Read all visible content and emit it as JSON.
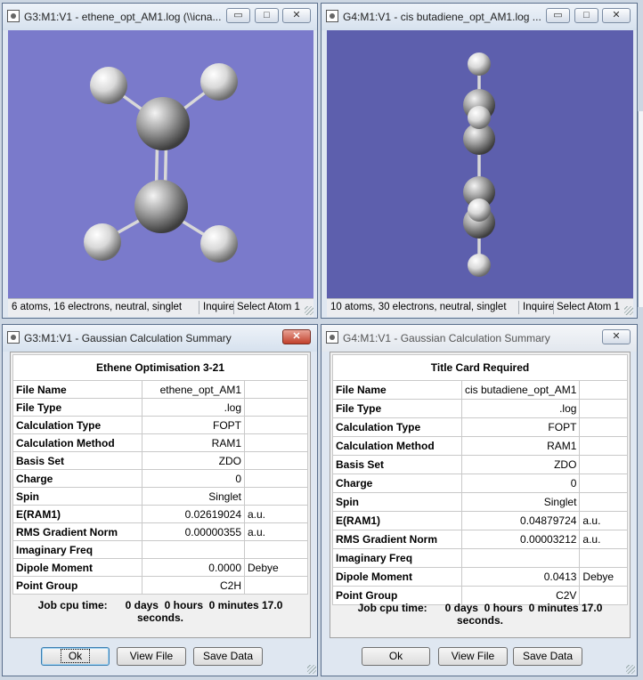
{
  "win_g3_view": {
    "title": "G3:M1:V1 - ethene_opt_AM1.log (\\\\icna...",
    "minimize": "▭",
    "maximize": "□",
    "close": "✕",
    "status": "6 atoms, 16 electrons, neutral, singlet",
    "inquire": "Inquire",
    "select_atom": "Select Atom 1",
    "bg_color": "#7a7acb"
  },
  "win_g4_view": {
    "title": "G4:M1:V1 - cis butadiene_opt_AM1.log ...",
    "minimize": "▭",
    "maximize": "□",
    "close": "✕",
    "status": "10 atoms, 30 electrons, neutral, singlet",
    "inquire": "Inquire",
    "select_atom": "Select Atom 1",
    "bg_color": "#5d5fad"
  },
  "summary_g3": {
    "title": "G3:M1:V1 - Gaussian Calculation Summary",
    "close": "✕",
    "heading": "Ethene Optimisation 3-21",
    "rows": [
      {
        "key": "File Name",
        "value": "ethene_opt_AM1",
        "unit": ""
      },
      {
        "key": "File Type",
        "value": ".log",
        "unit": ""
      },
      {
        "key": "Calculation Type",
        "value": "FOPT",
        "unit": ""
      },
      {
        "key": "Calculation Method",
        "value": "RAM1",
        "unit": ""
      },
      {
        "key": "Basis Set",
        "value": "ZDO",
        "unit": ""
      },
      {
        "key": "Charge",
        "value": "0",
        "unit": ""
      },
      {
        "key": "Spin",
        "value": "Singlet",
        "unit": ""
      },
      {
        "key": "E(RAM1)",
        "value": "0.02619024",
        "unit": "a.u."
      },
      {
        "key": "RMS Gradient Norm",
        "value": "0.00000355",
        "unit": "a.u."
      },
      {
        "key": "Imaginary Freq",
        "value": "",
        "unit": ""
      },
      {
        "key": "Dipole Moment",
        "value": "0.0000",
        "unit": "Debye"
      },
      {
        "key": "Point Group",
        "value": "C2H",
        "unit": ""
      }
    ],
    "cpu_line1": "Job cpu time:      0 days  0 hours  0 minutes 17.0",
    "cpu_line2": "seconds.",
    "ok": "Ok",
    "view_file": "View File",
    "save_data": "Save Data"
  },
  "summary_g4": {
    "title": "G4:M1:V1 - Gaussian Calculation Summary",
    "close": "✕",
    "heading": "Title Card Required",
    "rows": [
      {
        "key": "File Name",
        "value": "cis butadiene_opt_AM1",
        "unit": ""
      },
      {
        "key": "File Type",
        "value": ".log",
        "unit": ""
      },
      {
        "key": "Calculation Type",
        "value": "FOPT",
        "unit": ""
      },
      {
        "key": "Calculation Method",
        "value": "RAM1",
        "unit": ""
      },
      {
        "key": "Basis Set",
        "value": "ZDO",
        "unit": ""
      },
      {
        "key": "Charge",
        "value": "0",
        "unit": ""
      },
      {
        "key": "Spin",
        "value": "Singlet",
        "unit": ""
      },
      {
        "key": "E(RAM1)",
        "value": "0.04879724",
        "unit": "a.u."
      },
      {
        "key": "RMS Gradient Norm",
        "value": "0.00003212",
        "unit": "a.u."
      },
      {
        "key": "Imaginary Freq",
        "value": "",
        "unit": ""
      },
      {
        "key": "Dipole Moment",
        "value": "0.0413",
        "unit": "Debye"
      },
      {
        "key": "Point Group",
        "value": "C2V",
        "unit": ""
      }
    ],
    "cpu_line1": "Job cpu time:      0 days  0 hours  0 minutes 17.0",
    "cpu_line2": "seconds.",
    "ok": "Ok",
    "view_file": "View File",
    "save_data": "Save Data"
  }
}
